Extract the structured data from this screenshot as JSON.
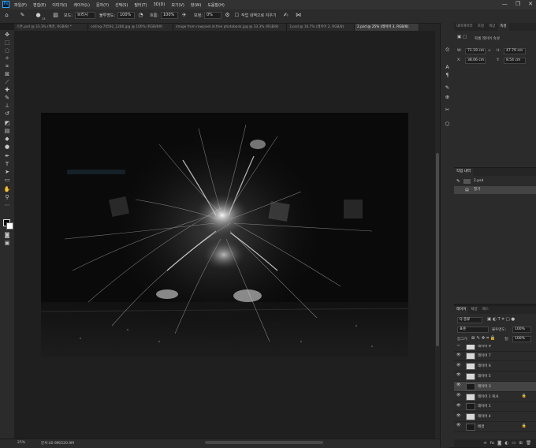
{
  "app": {
    "logo": "Ps",
    "menu": [
      "파일(F)",
      "편집(E)",
      "이미지(I)",
      "레이어(L)",
      "문자(Y)",
      "선택(S)",
      "필터(T)",
      "3D(D)",
      "보기(V)",
      "창(W)",
      "도움말(H)"
    ],
    "window_controls": [
      "—",
      "❐",
      "✕"
    ]
  },
  "options": {
    "mode_label": "모드:",
    "mode_value": "브러시",
    "opacity_label": "불투명도:",
    "opacity_value": "100%",
    "flow_label": "흐름:",
    "flow_value": "100%",
    "smoothing_label": "보정:",
    "smoothing_value": "0%",
    "history_label": "작업 내역으로 지우기",
    "brush_size": "13"
  },
  "tabs": [
    {
      "label": "스톤.psd @ 33.3% (배경, RGB/8) *",
      "active": false
    },
    {
      "label": "ceiling-70592_1280.jpg @ 100% (RGB/8#)",
      "active": false
    },
    {
      "label": "image from rawpixel.id.free photobank.jpg @ 33.3% (RGB/8)",
      "active": false
    },
    {
      "label": "3.psd @ 16.7% (레이어 2, RGB/8)",
      "active": false
    },
    {
      "label": "2.psd @ 25% (레이어 3, RGB/8)",
      "active": true
    }
  ],
  "status": {
    "zoom": "25%",
    "doc_info": "문서:40.9M/520.9M"
  },
  "properties_panel": {
    "tabs": [
      "내비게이터",
      "조정",
      "색상",
      "속성"
    ],
    "title": "픽셀 레이어 속성",
    "w_label": "W:",
    "w_value": "71.19 cm",
    "h_label": "H:",
    "h_value": "47.79 cm",
    "x_label": "X:",
    "x_value": "38.06 cm",
    "y_label": "Y:",
    "y_value": "8.54 cm"
  },
  "history_panel": {
    "title": "작업 내역",
    "items": [
      {
        "label": "2.psd"
      },
      {
        "label": "열기"
      }
    ]
  },
  "layers_panel": {
    "tabs": [
      "레이어",
      "채널",
      "패스"
    ],
    "kind_label": "Q 종류",
    "blend_mode": "표준",
    "opacity_label": "불투명도:",
    "opacity_value": "100%",
    "lock_label": "잠그기:",
    "fill_label": "칠:",
    "fill_value": "100%",
    "layers": [
      {
        "name": "레이어 9",
        "dark": false,
        "selected": false,
        "lock": false
      },
      {
        "name": "레이어 7",
        "dark": false,
        "selected": false,
        "lock": false
      },
      {
        "name": "레이어 6",
        "dark": false,
        "selected": false,
        "lock": false
      },
      {
        "name": "레이어 5",
        "dark": false,
        "selected": false,
        "lock": false
      },
      {
        "name": "레이어 3",
        "dark": true,
        "selected": true,
        "lock": false
      },
      {
        "name": "레이어 1 복사",
        "dark": false,
        "selected": false,
        "lock": true
      },
      {
        "name": "레이어 1",
        "dark": true,
        "selected": false,
        "lock": false
      },
      {
        "name": "레이어 4",
        "dark": false,
        "selected": false,
        "lock": false
      },
      {
        "name": "배경",
        "dark": true,
        "selected": false,
        "lock": true
      }
    ]
  },
  "colors": {
    "accent": "#31a8ff",
    "panel_bg": "#2b2b2b",
    "canvas_bg": "#1f1f1f",
    "selected_layer": "#444444"
  }
}
